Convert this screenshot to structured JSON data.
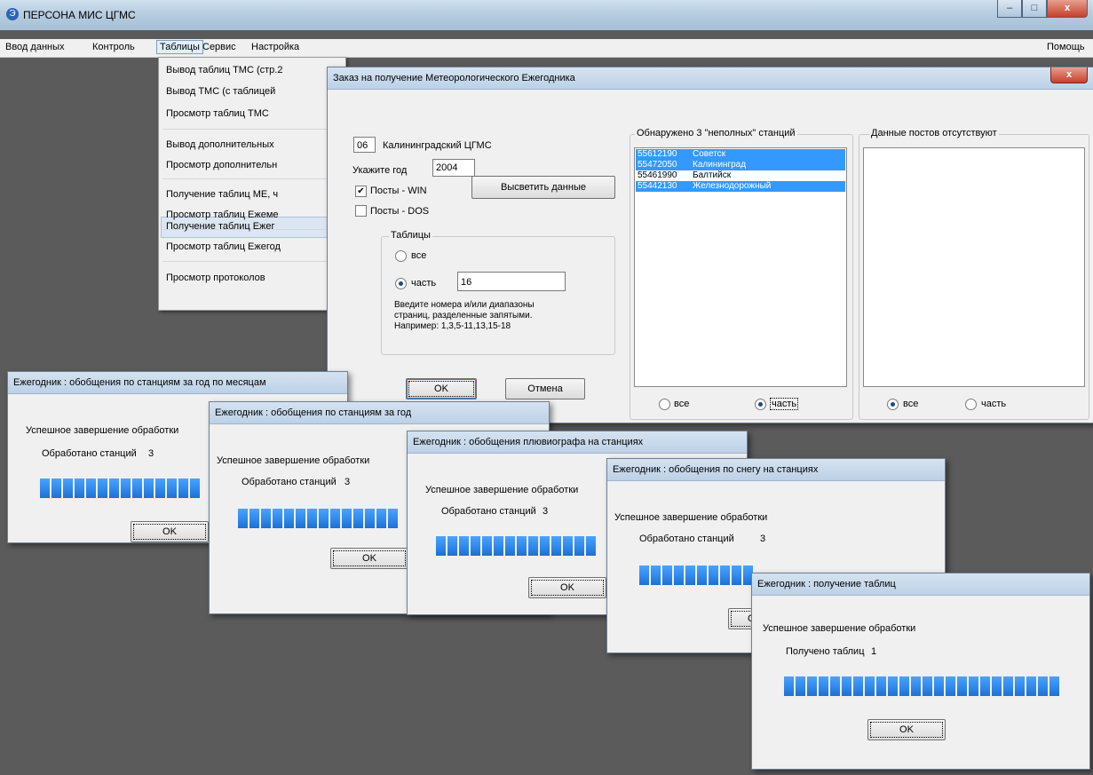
{
  "app": {
    "title": "ПЕРСОНА МИС ЦГМС"
  },
  "window_buttons": {
    "minimize": "–",
    "maximize": "□",
    "close": "x"
  },
  "menu": {
    "items": [
      "Ввод данных",
      "Контроль",
      "Таблицы",
      "Сервис",
      "Настройка"
    ],
    "help": "Помощь"
  },
  "dropdown": {
    "items": [
      "Вывод таблиц ТМС (стр.2",
      "Вывод  ТМС (с таблицей",
      "Просмотр таблиц ТМС",
      "Вывод дополнительных",
      "Просмотр дополнительн",
      "Получение таблиц МЕ, ч",
      "Просмотр таблиц Ежеме",
      "Получение таблиц Ежег",
      "Просмотр таблиц Ежегод",
      "Просмотр протоколов"
    ]
  },
  "order_dialog": {
    "title": "Заказ на получение Метеорологического Ежегодника",
    "close": "x",
    "code": "06",
    "org": "Калининградский ЦГМС",
    "year_label": "Укажите год",
    "year": "2004",
    "posts_win": "Посты - WIN",
    "posts_dos": "Посты - DOS",
    "highlight_button": "Высветить данные",
    "tables_group": "Таблицы",
    "radio_all": "все",
    "radio_part": "часть",
    "part_value": "16",
    "hint_line1": "Введите номера и/или диапазоны",
    "hint_line2": "страниц, разделенные запятыми.",
    "hint_line3": "Например: 1,3,5-11,13,15-18",
    "ok": "OK",
    "cancel": "Отмена",
    "found_label": "Обнаружено  3 \"неполных\" станций",
    "stations": [
      {
        "code": "55612190",
        "name": "Советск"
      },
      {
        "code": "55472050",
        "name": "Калининград"
      },
      {
        "code": "55461990",
        "name": "Балтийск"
      },
      {
        "code": "55442130",
        "name": "Железнодорожный"
      }
    ],
    "left_radio_all": "все",
    "left_radio_part": "часть",
    "posts_missing_label": "Данные постов отсутствуют",
    "right_radio_all": "все",
    "right_radio_part": "часть"
  },
  "progress_dialogs": [
    {
      "title": "Ежегодник : обобщения по станциям за год по месяцам",
      "status": "Успешное завершение обработки",
      "count_label": "Обработано станций",
      "count": "3",
      "ok": "OK"
    },
    {
      "title": "Ежегодник : обобщения по станциям за год",
      "status": "Успешное завершение обработки",
      "count_label": "Обработано станций",
      "count": "3",
      "ok": "OK"
    },
    {
      "title": "Ежегодник : обобщения плювиографа на станциях",
      "status": "Успешное завершение обработки",
      "count_label": "Обработано станций",
      "count": "3",
      "ok": "OK"
    },
    {
      "title": "Ежегодник : обобщения по снегу на станциях",
      "status": "Успешное завершение обработки",
      "count_label": "Обработано станций",
      "count": "3",
      "ok": "OK"
    },
    {
      "title": "Ежегодник : получение таблиц",
      "status": "Успешное завершение обработки",
      "count_label": "Получено таблиц",
      "count": "1",
      "ok": "OK"
    }
  ]
}
